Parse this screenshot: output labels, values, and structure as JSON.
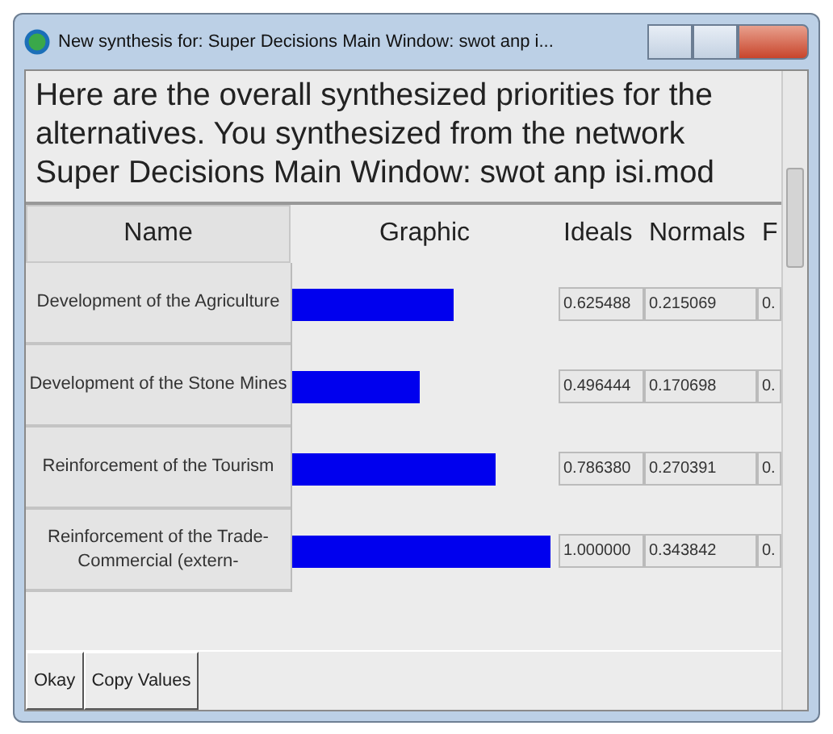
{
  "window": {
    "title": "New synthesis for: Super Decisions Main Window: swot anp i..."
  },
  "message": "Here are the overall synthesized priorities for the alternatives.  You synthesized from the network Super Decisions Main Window: swot anp isi.mod",
  "table": {
    "columns": [
      "Name",
      "Graphic",
      "Ideals",
      "Normals",
      "F"
    ],
    "rows": [
      {
        "name": "Development of the Agriculture",
        "level": 0.625,
        "ideals": "0.625488",
        "normals": "0.215069",
        "column_3": "0."
      },
      {
        "name": "Development of the Stone Mines",
        "level": 0.496,
        "ideals": "0.496444",
        "normals": "0.170698",
        "column_3": "0."
      },
      {
        "name": "Reinforcement of the Tourism",
        "level": 0.786,
        "ideals": "0.786380",
        "normals": "0.270391",
        "column_3": "0."
      },
      {
        "name": "Reinforcement of the Trade-Commercial (extern-",
        "level": 1.0,
        "ideals": "1.000000",
        "normals": "0.343842",
        "column_3": "0."
      }
    ]
  },
  "buttons": [
    "Okay",
    "Copy Values"
  ]
}
